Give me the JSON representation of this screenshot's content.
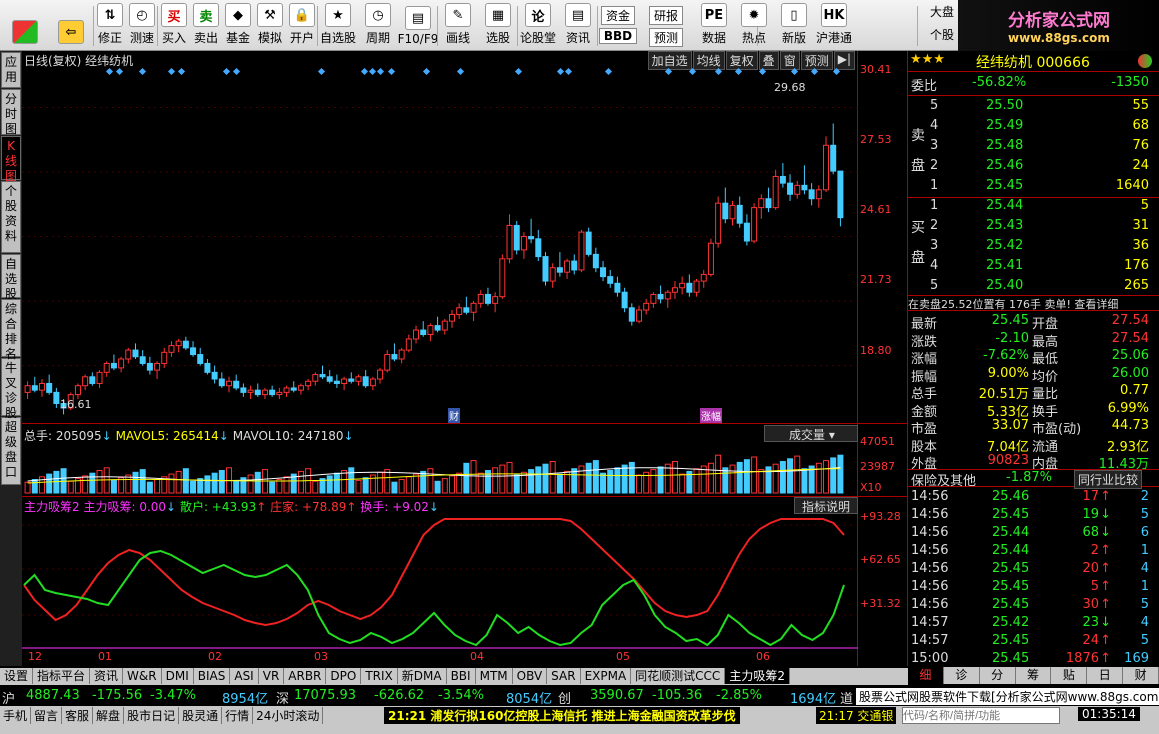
{
  "toolbar": {
    "items": [
      {
        "label": "",
        "icon": "grid-icon"
      },
      {
        "label": "",
        "icon": "back-arrow-icon"
      },
      {
        "label": "修正",
        "icon": "up-down-icon"
      },
      {
        "label": "测速",
        "icon": "clock-icon"
      },
      {
        "label": "买入",
        "icon": "buy-icon",
        "glyph": "买"
      },
      {
        "label": "卖出",
        "icon": "sell-icon",
        "glyph": "卖"
      },
      {
        "label": "基金",
        "icon": "fund-icon",
        "glyph": "◆"
      },
      {
        "label": "模拟",
        "icon": "hammer-icon",
        "glyph": "⚒"
      },
      {
        "label": "开户",
        "icon": "lock-icon",
        "glyph": "🔒"
      },
      {
        "label": "自选股",
        "icon": "stock-icon",
        "glyph": "★"
      },
      {
        "label": "周期",
        "icon": "period-icon",
        "glyph": "◷"
      },
      {
        "label": "F10/F9",
        "icon": "f10-icon",
        "glyph": "▤"
      },
      {
        "label": "画线",
        "icon": "pen-icon",
        "glyph": "✎"
      },
      {
        "label": "选股",
        "icon": "select-icon",
        "glyph": "▦"
      },
      {
        "label": "论股堂",
        "icon": "forum-icon",
        "glyph": "论"
      },
      {
        "label": "资讯",
        "icon": "news-icon",
        "glyph": "▤"
      },
      {
        "label": "资金",
        "icon": "capital-icon"
      },
      {
        "label": "BBD",
        "icon": "bbd-icon"
      },
      {
        "label": "研报",
        "icon": "report-icon"
      },
      {
        "label": "预测",
        "icon": "forecast-icon"
      },
      {
        "label": "数据",
        "icon": "pe-icon",
        "glyph": "PE"
      },
      {
        "label": "热点",
        "icon": "fire-icon",
        "glyph": "✹"
      },
      {
        "label": "新版",
        "icon": "new-version-icon",
        "glyph": "▯"
      },
      {
        "label": "沪港通",
        "icon": "hkex-icon",
        "glyph": "HK"
      },
      {
        "label": "大盘",
        "icon": "market-icon"
      },
      {
        "label": "个股",
        "icon": "single-stock-icon"
      }
    ]
  },
  "brand": {
    "title": "分析家公式网",
    "url": "www.88gs.com"
  },
  "sidetabs": [
    "应用",
    "分时图",
    "K线图",
    "个股资料",
    "自选股",
    "综合排名",
    "牛叉诊股",
    "超级盘口"
  ],
  "chart": {
    "header_left": "日线(复权)  经纬纺机",
    "header_tools": [
      "加自选",
      "均线",
      "复权",
      "叠",
      "窗",
      "预测",
      "▶|"
    ],
    "price_labels": [
      "30.41",
      "27.53",
      "24.61",
      "21.73",
      "18.80"
    ],
    "high_label": "29.68",
    "low_label": "16.61",
    "marker1": "财",
    "marker2": "涨幅",
    "vol_header": {
      "total": "总手: 205095",
      "mavol5": "MAVOL5: 265414",
      "mavol10": "MAVOL10: 247180"
    },
    "vol_dropdown": "成交量",
    "vol_labels": [
      "47051",
      "23987",
      "X10"
    ],
    "ind_header": {
      "name": "主力吸筹2",
      "main": "主力吸筹: 0.00",
      "retail": "散户: +43.93",
      "dealer": "庄家: +78.89",
      "turnover": "换手: +9.02"
    },
    "ind_button": "指标说明",
    "ind_labels": [
      "+93.28",
      "+62.65",
      "+31.32"
    ],
    "months": [
      "12",
      "01",
      "02",
      "03",
      "04",
      "05",
      "06"
    ]
  },
  "stock": {
    "name": "经纬纺机 000666",
    "stars": "★★★"
  },
  "orderbook": {
    "ratio_label": "委比",
    "ratio": "-56.82%",
    "diff": "-1350",
    "sell_label": "卖盘",
    "buy_label": "买盘",
    "sell": [
      [
        "5",
        "25.50",
        "55"
      ],
      [
        "4",
        "25.49",
        "68"
      ],
      [
        "3",
        "25.48",
        "76"
      ],
      [
        "2",
        "25.46",
        "24"
      ],
      [
        "1",
        "25.45",
        "1640"
      ]
    ],
    "buy": [
      [
        "1",
        "25.44",
        "5"
      ],
      [
        "2",
        "25.43",
        "31"
      ],
      [
        "3",
        "25.42",
        "36"
      ],
      [
        "4",
        "25.41",
        "176"
      ],
      [
        "5",
        "25.40",
        "265"
      ]
    ],
    "note": "在卖盘25.52位置有 176手  卖单! 查看详细"
  },
  "quote": [
    [
      "最新",
      "25.45",
      "开盘",
      "27.54"
    ],
    [
      "涨跌",
      "-2.10",
      "最高",
      "27.54"
    ],
    [
      "涨幅",
      "-7.62%",
      "最低",
      "25.06"
    ],
    [
      "振幅",
      "9.00%",
      "均价",
      "26.00"
    ],
    [
      "总手",
      "20.51万",
      "量比",
      "0.77"
    ],
    [
      "金额",
      "5.33亿",
      "换手",
      "6.99%"
    ],
    [
      "市盈",
      "33.07",
      "市盈(动)",
      "44.73"
    ],
    [
      "股本",
      "7.04亿",
      "流通",
      "2.93亿"
    ],
    [
      "外盘",
      "90823",
      "内盘",
      "11.43万"
    ]
  ],
  "sector": {
    "name": "保险及其他",
    "pct": "-1.87%",
    "compare": "同行业比较"
  },
  "ticks": [
    [
      "14:56",
      "25.46",
      "17",
      "↑",
      "2"
    ],
    [
      "14:56",
      "25.45",
      "19",
      "↓",
      "5"
    ],
    [
      "14:56",
      "25.44",
      "68",
      "↓",
      "6"
    ],
    [
      "14:56",
      "25.44",
      "2",
      "↑",
      "1"
    ],
    [
      "14:56",
      "25.45",
      "20",
      "↑",
      "4"
    ],
    [
      "14:56",
      "25.45",
      "5",
      "↑",
      "1"
    ],
    [
      "14:56",
      "25.45",
      "30",
      "↑",
      "5"
    ],
    [
      "14:57",
      "25.42",
      "23",
      "↓",
      "4"
    ],
    [
      "14:57",
      "25.45",
      "24",
      "↑",
      "5"
    ],
    [
      "15:00",
      "25.45",
      "1876",
      "↑",
      "169"
    ]
  ],
  "rtabs": [
    "细",
    "诊",
    "分",
    "筹",
    "贴",
    "日",
    "财"
  ],
  "bottomtabs": [
    "设置",
    "指标平台",
    "资讯",
    "W&R",
    "DMI",
    "BIAS",
    "ASI",
    "VR",
    "ARBR",
    "DPO",
    "TRIX",
    "新DMA",
    "BBI",
    "MTM",
    "OBV",
    "SAR",
    "EXPMA",
    "同花顺测试CCC",
    "主力吸筹2"
  ],
  "status": {
    "sh_label": "沪",
    "sh_idx": "4887.43",
    "sh_chg": "-175.56",
    "sh_pct": "-3.47%",
    "sh_amt": "8954亿",
    "sz_label": "深",
    "sz_idx": "17075.93",
    "sz_chg": "-626.62",
    "sz_pct": "-3.54%",
    "sz_amt": "8054亿",
    "cy_label": "创",
    "cy_idx": "3590.67",
    "cy_chg": "-105.36",
    "cy_pct": "-2.85%",
    "cy_amt": "1694亿",
    "cy_tail": "道"
  },
  "footer": {
    "items": [
      "手机",
      "留言",
      "客服",
      "解盘",
      "股市日记",
      "股灵通",
      "行情",
      "24小时滚动"
    ],
    "news1": "21:21 浦发行拟160亿控股上海信托 推进上海金融国资改革步伐",
    "news2": "21:17 交通银",
    "ad": "股票公式网股票软件下载[分析家公式网www.88gs.com",
    "search_placeholder": "代码/名称/简拼/功能",
    "time": "01:35:14"
  },
  "chart_data": {
    "type": "candlestick",
    "ohlc": [
      [
        17.6,
        18.1,
        17.3,
        17.9
      ],
      [
        17.9,
        18.3,
        17.6,
        17.7
      ],
      [
        17.7,
        18.2,
        17.4,
        18.0
      ],
      [
        18.0,
        18.4,
        17.5,
        17.6
      ],
      [
        17.6,
        17.8,
        16.9,
        17.1
      ],
      [
        17.1,
        17.3,
        16.61,
        16.9
      ],
      [
        16.9,
        17.6,
        16.8,
        17.5
      ],
      [
        17.5,
        18.0,
        17.3,
        17.9
      ],
      [
        17.9,
        18.4,
        17.7,
        18.3
      ],
      [
        18.3,
        18.5,
        17.9,
        18.0
      ],
      [
        18.0,
        18.6,
        17.8,
        18.5
      ],
      [
        18.5,
        19.0,
        18.3,
        18.9
      ],
      [
        18.9,
        19.3,
        18.6,
        18.7
      ],
      [
        18.7,
        19.2,
        18.5,
        19.1
      ],
      [
        19.1,
        19.6,
        18.9,
        19.5
      ],
      [
        19.5,
        19.8,
        19.1,
        19.2
      ],
      [
        19.2,
        19.5,
        18.8,
        18.9
      ],
      [
        18.9,
        19.2,
        18.4,
        18.6
      ],
      [
        18.6,
        19.0,
        18.2,
        18.9
      ],
      [
        18.9,
        19.6,
        18.7,
        19.4
      ],
      [
        19.4,
        19.9,
        19.2,
        19.7
      ],
      [
        19.7,
        20.0,
        19.4,
        19.9
      ],
      [
        19.9,
        20.1,
        19.5,
        19.6
      ],
      [
        19.6,
        19.9,
        19.2,
        19.3
      ],
      [
        19.3,
        19.6,
        18.8,
        18.9
      ],
      [
        18.9,
        19.1,
        18.4,
        18.5
      ],
      [
        18.5,
        18.8,
        18.0,
        18.2
      ],
      [
        18.2,
        18.5,
        17.8,
        17.9
      ],
      [
        17.9,
        18.3,
        17.6,
        18.1
      ],
      [
        18.1,
        18.4,
        17.7,
        17.8
      ],
      [
        17.8,
        18.0,
        17.4,
        17.6
      ],
      [
        17.6,
        17.9,
        17.3,
        17.7
      ],
      [
        17.7,
        18.0,
        17.4,
        17.5
      ],
      [
        17.5,
        17.8,
        17.3,
        17.7
      ],
      [
        17.7,
        17.9,
        17.4,
        17.5
      ],
      [
        17.5,
        17.8,
        17.3,
        17.6
      ],
      [
        17.6,
        17.9,
        17.4,
        17.8
      ],
      [
        17.8,
        18.1,
        17.6,
        17.7
      ],
      [
        17.7,
        18.0,
        17.5,
        17.9
      ],
      [
        17.9,
        18.2,
        17.7,
        18.1
      ],
      [
        18.1,
        18.5,
        17.9,
        18.4
      ],
      [
        18.4,
        18.8,
        18.2,
        18.3
      ],
      [
        18.3,
        18.6,
        18.0,
        18.1
      ],
      [
        18.1,
        18.4,
        17.8,
        18.0
      ],
      [
        18.0,
        18.3,
        17.7,
        18.2
      ],
      [
        18.2,
        18.5,
        18.0,
        18.1
      ],
      [
        18.1,
        18.4,
        17.9,
        18.3
      ],
      [
        18.3,
        18.6,
        17.8,
        17.9
      ],
      [
        17.9,
        18.3,
        17.7,
        18.2
      ],
      [
        18.2,
        18.7,
        18.0,
        18.6
      ],
      [
        18.6,
        19.5,
        18.5,
        19.3
      ],
      [
        19.3,
        19.8,
        19.0,
        19.1
      ],
      [
        19.1,
        19.6,
        18.9,
        19.5
      ],
      [
        19.5,
        20.2,
        19.4,
        20.0
      ],
      [
        20.0,
        20.6,
        19.8,
        20.4
      ],
      [
        20.4,
        20.8,
        20.1,
        20.2
      ],
      [
        20.2,
        20.7,
        19.9,
        20.6
      ],
      [
        20.6,
        21.0,
        20.3,
        20.4
      ],
      [
        20.4,
        20.9,
        20.2,
        20.8
      ],
      [
        20.8,
        21.3,
        20.5,
        21.1
      ],
      [
        21.1,
        21.6,
        20.9,
        21.4
      ],
      [
        21.4,
        21.9,
        21.1,
        21.2
      ],
      [
        21.2,
        21.7,
        20.8,
        21.6
      ],
      [
        21.6,
        22.2,
        21.4,
        22.0
      ],
      [
        22.0,
        22.3,
        21.5,
        21.6
      ],
      [
        21.6,
        22.1,
        21.2,
        21.9
      ],
      [
        21.9,
        23.8,
        21.8,
        23.6
      ],
      [
        23.6,
        25.6,
        23.4,
        25.1
      ],
      [
        25.1,
        25.3,
        23.8,
        24.0
      ],
      [
        24.0,
        24.8,
        23.6,
        24.6
      ],
      [
        24.6,
        25.4,
        24.3,
        24.5
      ],
      [
        24.5,
        24.9,
        23.5,
        23.7
      ],
      [
        23.7,
        23.9,
        22.4,
        22.6
      ],
      [
        22.6,
        23.4,
        22.3,
        23.2
      ],
      [
        23.2,
        23.9,
        22.8,
        23.0
      ],
      [
        23.0,
        23.6,
        22.7,
        23.5
      ],
      [
        23.5,
        23.8,
        22.9,
        23.1
      ],
      [
        23.1,
        24.9,
        23.0,
        24.8
      ],
      [
        24.8,
        25.0,
        23.7,
        23.8
      ],
      [
        23.8,
        24.1,
        23.0,
        23.2
      ],
      [
        23.2,
        23.5,
        22.6,
        22.8
      ],
      [
        22.8,
        23.1,
        22.3,
        22.5
      ],
      [
        22.5,
        22.8,
        21.9,
        22.1
      ],
      [
        22.1,
        22.3,
        21.2,
        21.4
      ],
      [
        21.4,
        21.6,
        20.6,
        20.8
      ],
      [
        20.8,
        21.5,
        20.7,
        21.3
      ],
      [
        21.3,
        21.8,
        21.1,
        21.6
      ],
      [
        21.6,
        22.1,
        21.4,
        22.0
      ],
      [
        22.0,
        22.4,
        21.6,
        21.8
      ],
      [
        21.8,
        22.2,
        21.4,
        22.1
      ],
      [
        22.1,
        22.6,
        21.8,
        22.3
      ],
      [
        22.3,
        22.8,
        22.0,
        22.5
      ],
      [
        22.5,
        22.9,
        21.9,
        22.1
      ],
      [
        22.1,
        22.7,
        21.9,
        22.6
      ],
      [
        22.6,
        23.1,
        22.3,
        22.9
      ],
      [
        22.9,
        24.5,
        22.8,
        24.3
      ],
      [
        24.3,
        26.4,
        24.1,
        26.1
      ],
      [
        26.1,
        26.8,
        25.2,
        25.4
      ],
      [
        25.4,
        26.2,
        25.1,
        26.0
      ],
      [
        26.0,
        26.4,
        25.0,
        25.2
      ],
      [
        25.2,
        25.6,
        24.2,
        24.4
      ],
      [
        24.4,
        26.1,
        24.3,
        25.9
      ],
      [
        25.9,
        26.5,
        25.4,
        26.3
      ],
      [
        26.3,
        26.8,
        25.7,
        25.9
      ],
      [
        25.9,
        27.6,
        25.8,
        27.3
      ],
      [
        27.3,
        27.9,
        26.8,
        27.0
      ],
      [
        27.0,
        27.4,
        26.2,
        26.5
      ],
      [
        26.5,
        27.1,
        26.3,
        26.9
      ],
      [
        26.9,
        27.8,
        26.5,
        26.7
      ],
      [
        26.7,
        27.0,
        26.0,
        26.3
      ],
      [
        26.3,
        26.9,
        25.9,
        26.7
      ],
      [
        26.7,
        29.1,
        26.6,
        28.7
      ],
      [
        28.7,
        29.68,
        27.4,
        27.54
      ],
      [
        27.54,
        27.54,
        25.06,
        25.45
      ]
    ],
    "price_ylim": [
      16.0,
      30.6
    ],
    "volume_total": 205095,
    "mavol5": 265414,
    "mavol10": 247180,
    "indicator": {
      "retail": 43.93,
      "dealer": 78.89,
      "turnover": 9.02
    }
  }
}
